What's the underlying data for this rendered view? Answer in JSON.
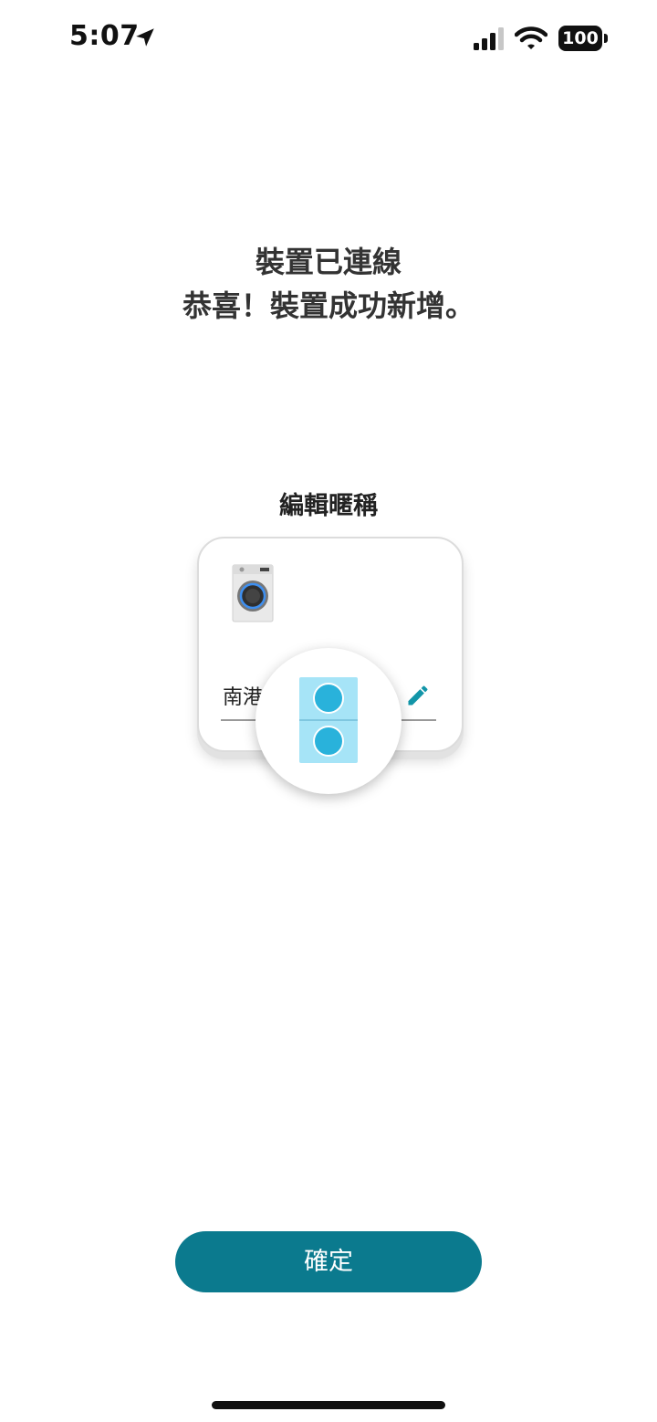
{
  "status_bar": {
    "time": "5:07",
    "battery": "100",
    "icons": [
      "location-arrow-icon",
      "cellular-signal-icon",
      "wifi-icon",
      "battery-icon"
    ]
  },
  "header": {
    "title": "裝置已連線",
    "subtitle": "恭喜！裝置成功新增。"
  },
  "nickname": {
    "label": "編輯暱稱",
    "value": "南港"
  },
  "colors": {
    "accent": "#0b7a8e",
    "edit_icon": "#1295a8",
    "machine_blue": "#29b2db",
    "machine_bg": "#a6e4f7"
  },
  "confirm_label": "確定"
}
